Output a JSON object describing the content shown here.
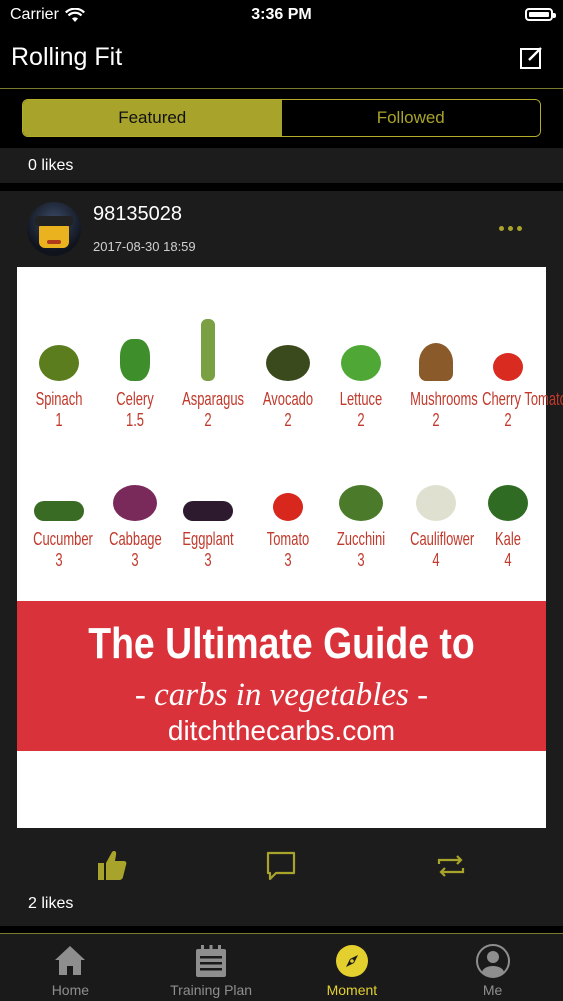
{
  "status_bar": {
    "carrier": "Carrier",
    "time": "3:36 PM"
  },
  "nav": {
    "title": "Rolling Fit"
  },
  "segments": [
    {
      "label": "Featured",
      "active": true
    },
    {
      "label": "Followed",
      "active": false
    }
  ],
  "prev_post": {
    "likes": "0 likes"
  },
  "post": {
    "username": "98135028",
    "date": "2017-08-30 18:59",
    "likes": "2 likes",
    "image": {
      "vegetables": [
        {
          "name": "Spinach",
          "qty": "1",
          "color": "#5b7d1e",
          "shape": "blob"
        },
        {
          "name": "Celery",
          "qty": "1.5",
          "color": "#3e8f2b",
          "shape": "bunch"
        },
        {
          "name": "Asparagus",
          "qty": "2",
          "color": "#7aa043",
          "shape": "stick"
        },
        {
          "name": "Avocado",
          "qty": "2",
          "color": "#3a4a1c",
          "shape": "oval"
        },
        {
          "name": "Lettuce",
          "qty": "2",
          "color": "#4fa836",
          "shape": "blob"
        },
        {
          "name": "Mushrooms",
          "qty": "2",
          "color": "#8a5a2b",
          "shape": "mushroom"
        },
        {
          "name": "Cherry Tomatoes",
          "qty": "2",
          "color": "#d92b1f",
          "shape": "tomato"
        },
        {
          "name": "Cucumber",
          "qty": "3",
          "color": "#3a6b24",
          "shape": "log"
        },
        {
          "name": "Cabbage",
          "qty": "3",
          "color": "#7a2a5a",
          "shape": "oval"
        },
        {
          "name": "Eggplant",
          "qty": "3",
          "color": "#2e1a2e",
          "shape": "log"
        },
        {
          "name": "Tomato",
          "qty": "3",
          "color": "#d8271c",
          "shape": "tomato"
        },
        {
          "name": "Zucchini",
          "qty": "3",
          "color": "#4a7a2a",
          "shape": "oval"
        },
        {
          "name": "Cauliflower",
          "qty": "4",
          "color": "#dfe0cf",
          "shape": "blob"
        },
        {
          "name": "Kale",
          "qty": "4",
          "color": "#2f6b22",
          "shape": "blob"
        }
      ],
      "banner_line1": "The Ultimate Guide to",
      "banner_line2": "- carbs in vegetables -",
      "banner_line3": "ditchthecarbs.com"
    }
  },
  "tabs": [
    {
      "label": "Home",
      "icon": "home-icon",
      "active": false
    },
    {
      "label": "Training Plan",
      "icon": "calendar-icon",
      "active": false
    },
    {
      "label": "Moment",
      "icon": "compass-icon",
      "active": true
    },
    {
      "label": "Me",
      "icon": "person-icon",
      "active": false
    }
  ],
  "colors": {
    "accent": "#a8a32a",
    "tab_active": "#e3d02f",
    "banner": "#d9323a"
  }
}
